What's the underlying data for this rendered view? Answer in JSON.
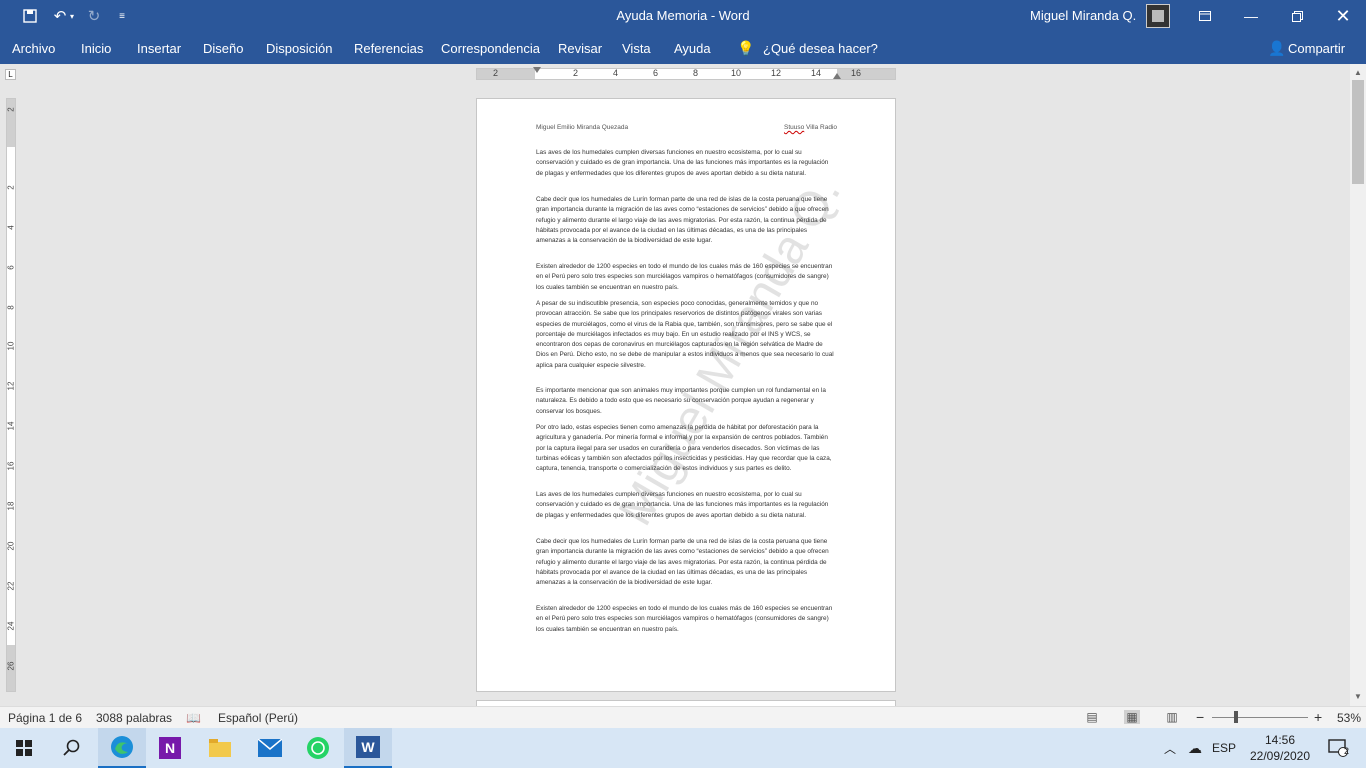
{
  "titlebar": {
    "doc_title": "Ayuda Memoria  -  Word",
    "user_name": "Miguel Miranda Q.",
    "undo_icon": "undo-icon",
    "redo_icon": "redo-icon",
    "save_icon": "save-icon"
  },
  "ribbon": {
    "tabs": [
      "Archivo",
      "Inicio",
      "Insertar",
      "Diseño",
      "Disposición",
      "Referencias",
      "Correspondencia",
      "Revisar",
      "Vista",
      "Ayuda"
    ],
    "tell_me": "¿Qué desea hacer?",
    "share": "Compartir"
  },
  "ruler": {
    "h_labels": [
      "2",
      "2",
      "4",
      "6",
      "8",
      "10",
      "12",
      "14",
      "16"
    ],
    "v_labels": [
      "2",
      "2",
      "4",
      "6",
      "8",
      "10",
      "12",
      "14",
      "16",
      "18",
      "20",
      "22",
      "24",
      "26"
    ]
  },
  "document": {
    "header_left": "Miguel Emilio Miranda Quezada",
    "header_right_underlined": "Stuuso",
    "header_right_rest": " Villa Radio",
    "watermark": "Miguel Miranda Q.",
    "paragraphs": [
      "Las aves de los humedales cumplen diversas funciones en nuestro ecosistema, por lo cual su conservación y cuidado es de gran importancia. Una de las funciones más importantes es la regulación de plagas y enfermedades que los diferentes grupos de aves aportan debido a su dieta natural.",
      "Cabe decir que los humedales de Lurín forman parte de una red de islas de la costa peruana que tiene gran importancia durante la migración de las aves como “estaciones de servicios” debido a que ofrecen refugio y alimento durante el largo viaje de las aves migratorias. Por esta razón, la continua pérdida de hábitats provocada por el avance de la ciudad en las últimas décadas, es una de las principales amenazas a la conservación de la biodiversidad de este lugar.",
      "Existen alrededor de 1200 especies en todo el mundo de los cuales más de 160 especies se encuentran en el Perú pero solo tres especies son murciélagos vampiros o hematófagos (consumidores de sangre) los cuales también se encuentran en nuestro país.",
      "A pesar de su indiscutible presencia, son especies poco conocidas, generalmente temidos y que no provocan atracción. Se sabe que los principales reservorios de distintos patógenos virales son varias especies de murciélagos, como el virus de la Rabia que, también, son transmisores, pero se sabe que el porcentaje de murciélagos infectados es muy bajo. En un estudio realizado por el INS y WCS, se encontraron dos cepas de coronavirus en murciélagos capturados en la región selvática de Madre de Dios en Perú. Dicho esto, no se debe de manipular a estos individuos a menos que sea necesario lo cual aplica para cualquier especie silvestre.",
      "Es importante mencionar que son animales muy importantes porque cumplen un rol fundamental en la naturaleza. Es debido a todo esto que es necesario su conservación porque ayudan a regenerar y conservar los bosques.",
      "Por otro lado, estas especies tienen como amenazas la perdida de hábitat por deforestación para la agricultura y ganadería. Por minería formal e informal y por la expansión de centros poblados. También por la captura ilegal para ser usados en curandería o para venderlos disecados. Son víctimas de las turbinas eólicas y también son afectados por los insecticidas y pesticidas. Hay que recordar que la caza, captura, tenencia, transporte o comercialización de estos individuos y sus partes es delito.",
      "Las aves de los humedales cumplen diversas funciones en nuestro ecosistema, por lo cual su conservación y cuidado es de gran importancia. Una de las funciones más importantes es la regulación de plagas y enfermedades que los diferentes grupos de aves aportan debido a su dieta natural.",
      "Cabe decir que los humedales de Lurín forman parte de una red de islas de la costa peruana que tiene gran importancia durante la migración de las aves como “estaciones de servicios” debido a que ofrecen refugio y alimento durante el largo viaje de las aves migratorias. Por esta razón, la continua pérdida de hábitats provocada por el avance de la ciudad en las últimas décadas, es una de las principales amenazas a la conservación de la biodiversidad de este lugar.",
      "Existen alrededor de 1200 especies en todo el mundo de los cuales más de 160 especies se encuentran en el Perú pero solo tres especies son murciélagos vampiros o hematófagos (consumidores de sangre) los cuales también se encuentran en nuestro país."
    ]
  },
  "statusbar": {
    "page": "Página 1 de 6",
    "words": "3088 palabras",
    "language": "Español (Perú)",
    "zoom": "53%"
  },
  "taskbar": {
    "lang": "ESP",
    "time": "14:56",
    "date": "22/09/2020",
    "notifications": "2"
  },
  "colors": {
    "word_blue": "#2b579a",
    "taskbar": "#d7e6f5"
  }
}
